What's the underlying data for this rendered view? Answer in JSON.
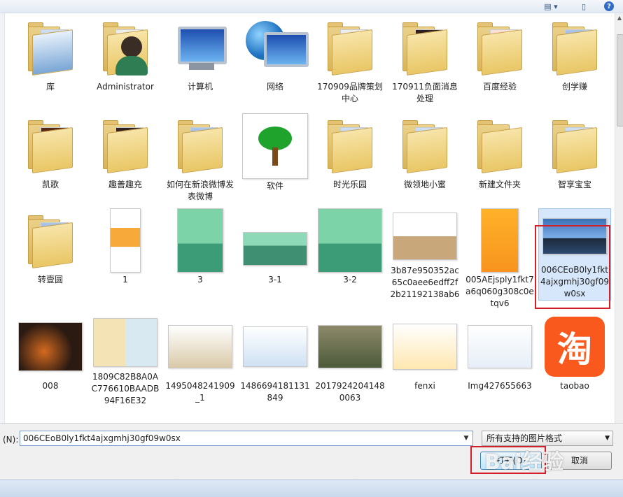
{
  "toolbar": {
    "view_icon": "view-options-icon",
    "pane_icon": "preview-pane-icon",
    "help_label": "?"
  },
  "items": [
    {
      "label": "库",
      "kind": "library"
    },
    {
      "label": "Administrator",
      "kind": "user"
    },
    {
      "label": "计算机",
      "kind": "computer"
    },
    {
      "label": "网络",
      "kind": "network"
    },
    {
      "label": "170909品牌策划中心",
      "kind": "folder"
    },
    {
      "label": "170911负面消息处理",
      "kind": "folder"
    },
    {
      "label": "百度经验",
      "kind": "folder"
    },
    {
      "label": "创学赚",
      "kind": "folder"
    },
    {
      "label": "凯歌",
      "kind": "folder"
    },
    {
      "label": "趣善趣充",
      "kind": "folder"
    },
    {
      "label": "如何在新浪微博发表微博",
      "kind": "folder"
    },
    {
      "label": "软件",
      "kind": "image"
    },
    {
      "label": "时光乐园",
      "kind": "folder"
    },
    {
      "label": "微领地小蜜",
      "kind": "folder"
    },
    {
      "label": "新建文件夹",
      "kind": "folder"
    },
    {
      "label": "智享宝宝",
      "kind": "folder"
    },
    {
      "label": "转壹圆",
      "kind": "folder"
    },
    {
      "label": "1",
      "kind": "image"
    },
    {
      "label": "3",
      "kind": "image"
    },
    {
      "label": "3-1",
      "kind": "image"
    },
    {
      "label": "3-2",
      "kind": "image"
    },
    {
      "label": "3b87e950352ac65c0aee6edff2f2b21192138ab6",
      "kind": "image"
    },
    {
      "label": "005AEjsply1fkt7a6q060g308c0etqv6",
      "kind": "image"
    },
    {
      "label": "006CEoB0ly1fkt4ajxgmhj30gf09w0sx",
      "kind": "image",
      "selected": true
    },
    {
      "label": "008",
      "kind": "image"
    },
    {
      "label": "1809C82B8A0AC776610BAADB94F16E32",
      "kind": "image"
    },
    {
      "label": "1495048241909_1",
      "kind": "image"
    },
    {
      "label": "1486694181131849",
      "kind": "image"
    },
    {
      "label": "20179242041480063",
      "kind": "image"
    },
    {
      "label": "fenxi",
      "kind": "image"
    },
    {
      "label": "Img427655663",
      "kind": "image"
    },
    {
      "label": "taobao",
      "kind": "image"
    }
  ],
  "taobao_glyph": "淘",
  "filename": {
    "label": "(N):",
    "value": "006CEoB0ly1fkt4ajxgmhj30gf09w0sx"
  },
  "filetype": {
    "value": "所有支持的图片格式"
  },
  "buttons": {
    "open": "打开(O)",
    "cancel": "取消"
  },
  "watermark": "Bai经验",
  "colors": {
    "highlight": "#d21f28",
    "selection": "#d7e7fb"
  }
}
